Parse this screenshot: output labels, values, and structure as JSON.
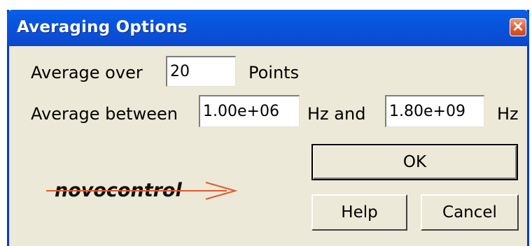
{
  "window": {
    "title": "Averaging Options"
  },
  "form": {
    "average_over_label": "Average over",
    "points_value": "20",
    "points_label": "Points",
    "average_between_label": "Average between",
    "freq_low": "1.00e+06",
    "hz_and_label": "Hz and",
    "freq_high": "1.80e+09",
    "hz_label": "Hz"
  },
  "buttons": {
    "ok": "OK",
    "help": "Help",
    "cancel": "Cancel"
  },
  "logo": {
    "text": "novocontrol"
  },
  "colors": {
    "titlebar": "#0a56e0",
    "dialog_bg": "#ece9d8",
    "close": "#e0592d",
    "logo_arrow": "#e05a2a"
  }
}
